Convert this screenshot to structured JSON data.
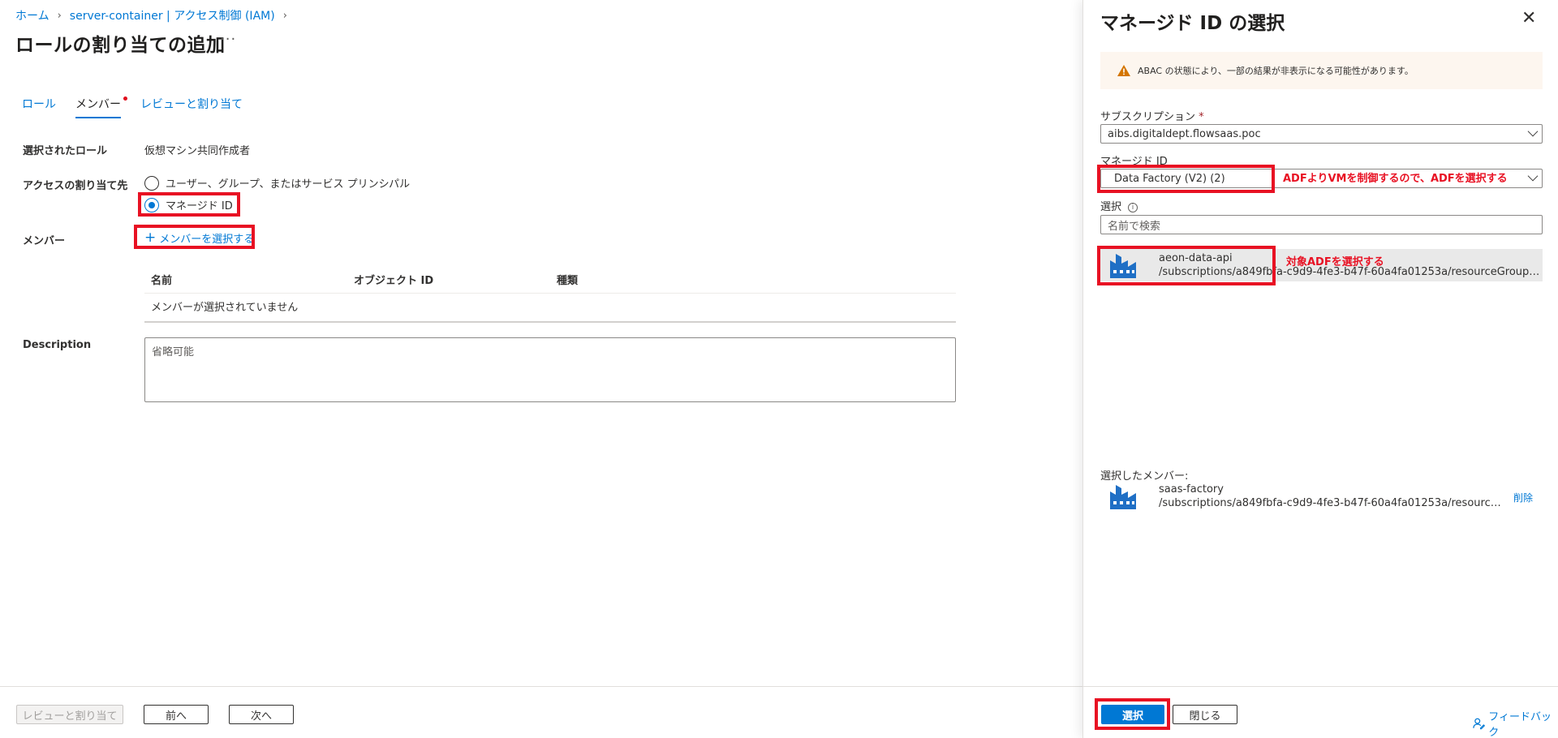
{
  "breadcrumb": {
    "home": "ホーム",
    "parent": "server-container | アクセス制御 (IAM)"
  },
  "page": {
    "title": "ロールの割り当ての追加",
    "more": "···"
  },
  "tabs": [
    {
      "label": "ロール"
    },
    {
      "label": "メンバー"
    },
    {
      "label": "レビューと割り当て"
    }
  ],
  "form": {
    "selected_role_label": "選択されたロール",
    "selected_role_value": "仮想マシン共同作成者",
    "assign_access_label": "アクセスの割り当て先",
    "option_user": "ユーザー、グループ、またはサービス プリンシパル",
    "option_managed": "マネージド ID",
    "members_label": "メンバー",
    "add_member_label": "メンバーを選択する",
    "table_headers": [
      "名前",
      "オブジェクト ID",
      "種類"
    ],
    "no_members": "メンバーが選択されていません",
    "description_label": "Description",
    "description_placeholder": "省略可能"
  },
  "footer": {
    "review_assign": "レビューと割り当て",
    "prev": "前へ",
    "next": "次へ"
  },
  "panel": {
    "title": "マネージド ID の選択",
    "warning": "ABAC の状態により、一部の結果が非表示になる可能性があります。",
    "subscription_label": "サブスクリプション",
    "subscription_required": "*",
    "subscription_value": "aibs.digitaldept.flowsaas.poc",
    "managed_id_label": "マネージド ID",
    "managed_id_value": "Data Factory (V2) (2)",
    "select_label": "選択",
    "search_placeholder": "名前で検索",
    "results": [
      {
        "name": "aeon-data-api",
        "path": "/subscriptions/a849fbfa-c9d9-4fe3-b47f-60a4fa01253a/resourceGroups/…"
      }
    ],
    "selected_members_label": "選択したメンバー:",
    "selected_members": [
      {
        "name": "saas-factory",
        "path": "/subscriptions/a849fbfa-c9d9-4fe3-b47f-60a4fa01253a/resourceGro…"
      }
    ],
    "remove_label": "削除",
    "select_button": "選択",
    "close_button": "閉じる",
    "feedback": "フィードバック"
  },
  "annotations": {
    "adf_note": "ADFよりVMを制御するので、ADFを選択する",
    "target_note": "対象ADFを選択する"
  },
  "colors": {
    "accent": "#0078d4",
    "highlight_box": "#e81123",
    "warning_icon": "#d47500"
  }
}
